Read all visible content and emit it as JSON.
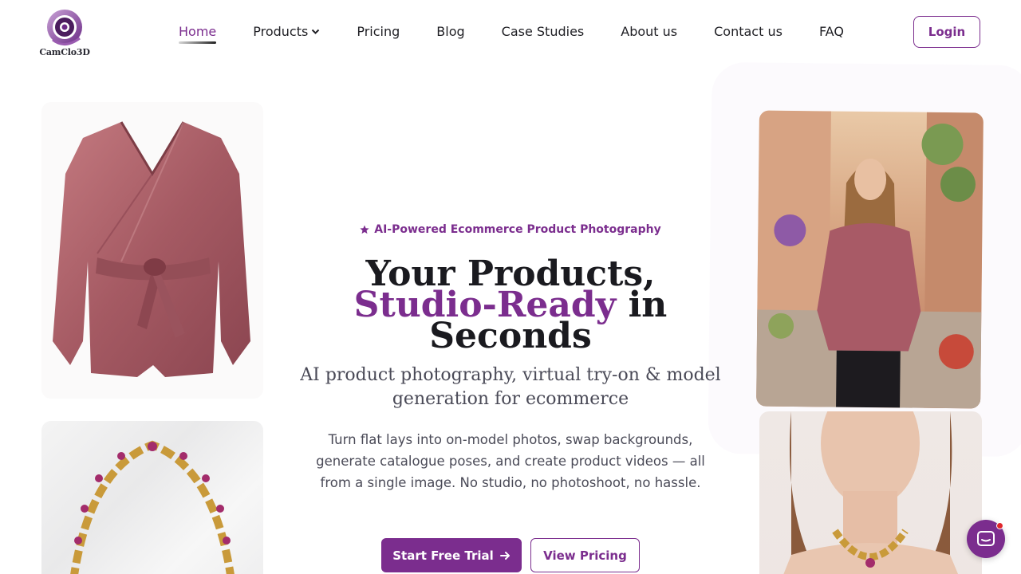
{
  "brand": {
    "logo_text": "CamClo3D",
    "accent": "#7b2d8e"
  },
  "nav": {
    "items": [
      {
        "label": "Home",
        "active": true
      },
      {
        "label": "Products",
        "has_dropdown": true
      },
      {
        "label": "Pricing"
      },
      {
        "label": "Blog"
      },
      {
        "label": "Case Studies"
      },
      {
        "label": "About us"
      },
      {
        "label": "Contact us"
      },
      {
        "label": "FAQ"
      }
    ],
    "login_label": "Login"
  },
  "hero": {
    "badge": "AI-Powered Ecommerce Product Photography",
    "headline_line1": "Your Products,",
    "headline_accent": "Studio-Ready",
    "headline_rest": "in",
    "headline_line3": "Seconds",
    "subheadline": "AI product photography, virtual try-on & model generation for ecommerce",
    "description": "Turn flat lays into on-model photos, swap backgrounds, generate catalogue poses, and create product videos — all from a single image. No studio, no photoshoot, no hassle.",
    "primary_cta": "Start Free Trial",
    "secondary_cta": "View Pricing"
  },
  "icons": {
    "badge": "star-icon",
    "cta_arrow": "arrow-right-icon",
    "dropdown": "chevron-down-icon",
    "chat": "chat-icon"
  },
  "images": [
    "blouse-product-image",
    "necklace-product-image",
    "model-wearing-blouse-image",
    "model-wearing-necklace-image"
  ]
}
